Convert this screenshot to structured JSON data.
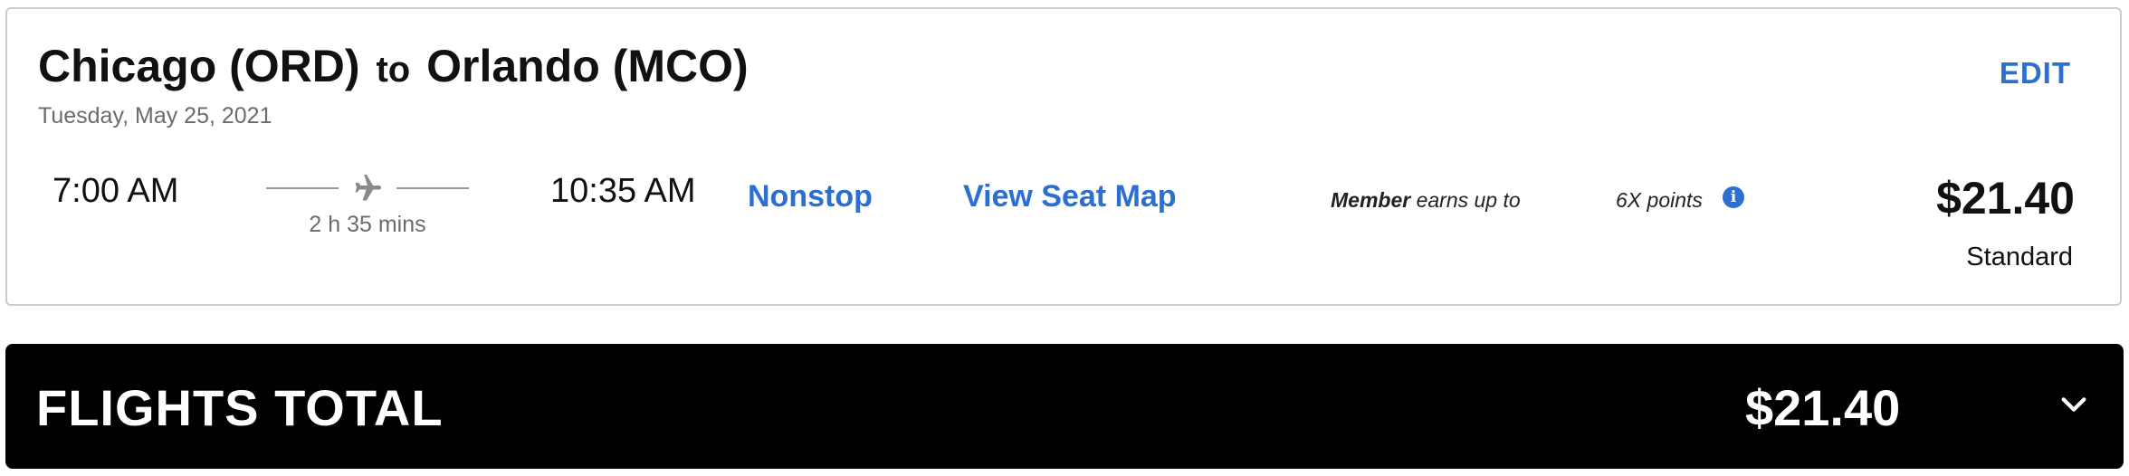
{
  "flight": {
    "origin": "Chicago (ORD)",
    "connector": "to",
    "destination": "Orlando (MCO)",
    "date": "Tuesday, May 25, 2021",
    "edit_label": "EDIT",
    "depart_time": "7:00 AM",
    "arrive_time": "10:35 AM",
    "duration": "2 h 35 mins",
    "stops_label": "Nonstop",
    "seat_map_label": "View Seat Map",
    "member_bold": "Member",
    "member_rest": " earns up to",
    "points_label": "6X points",
    "info_icon_glyph": "i",
    "price": "$21.40",
    "fare_class": "Standard",
    "icons": {
      "plane": "airplane-icon",
      "info": "info-icon"
    }
  },
  "total": {
    "label": "FLIGHTS TOTAL",
    "price": "$21.40",
    "toggle_icon": "chevron-down-icon"
  },
  "colors": {
    "accent": "#2a6fd1",
    "total_bar": "#000000",
    "muted_text": "#6b6b6b",
    "card_border": "#cccccc"
  }
}
